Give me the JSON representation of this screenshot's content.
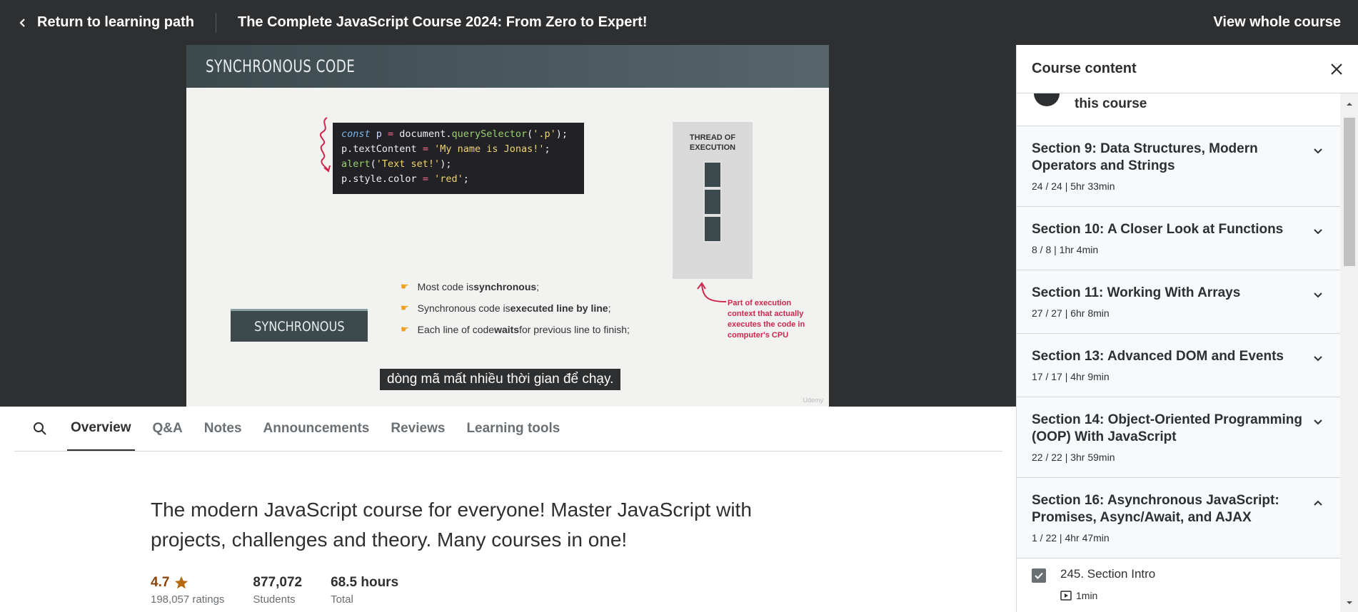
{
  "topbar": {
    "back_label": "Return to learning path",
    "course_title": "The Complete JavaScript Course 2024: From Zero to Expert!",
    "view_whole_label": "View whole course"
  },
  "video": {
    "slide_title": "SYNCHRONOUS CODE",
    "code_lines": [
      [
        "const",
        " p ",
        "=",
        " document",
        ".",
        "querySelector",
        "(",
        "'.p'",
        ");"
      ],
      [
        "p",
        ".textContent ",
        "=",
        " ",
        "'My name is Jonas!'",
        ";"
      ],
      [
        "alert",
        "(",
        "'Text set!'",
        ");"
      ],
      [
        "p",
        ".style.color ",
        "=",
        " ",
        "'red'",
        ";"
      ]
    ],
    "thread_label_1": "THREAD OF",
    "thread_label_2": "EXECUTION",
    "sync_label": "SYNCHRONOUS",
    "bullets": [
      {
        "pre": "Most code is ",
        "bold": "synchronous",
        "post": ";"
      },
      {
        "pre": "Synchronous code is ",
        "bold": "executed line by line",
        "post": ";"
      },
      {
        "pre": "Each line of code ",
        "bold": "waits",
        "post": " for previous line to finish;"
      }
    ],
    "note_lines": [
      "Part of execution",
      "context that actually",
      "executes the code in",
      "computer's CPU"
    ],
    "caption": "dòng mã mất nhiều thời gian để chạy.",
    "watermark": "Udemy",
    "accent_color": "#d0264e"
  },
  "tabs": {
    "search_icon": "search-icon",
    "items": [
      "Overview",
      "Q&A",
      "Notes",
      "Announcements",
      "Reviews",
      "Learning tools"
    ],
    "active": "Overview"
  },
  "overview": {
    "headline": "The modern JavaScript course for everyone! Master JavaScript with projects, challenges and theory. Many courses in one!",
    "rating_value": "4.7",
    "rating_count": "198,057 ratings",
    "students_value": "877,072",
    "students_label": "Students",
    "hours_value": "68.5 hours",
    "hours_label": "Total"
  },
  "sidebar": {
    "title": "Course content",
    "partial_item": "this course",
    "sections": [
      {
        "title": "Section 9: Data Structures, Modern Operators and Strings",
        "meta": "24 / 24 | 5hr 33min",
        "expanded": false
      },
      {
        "title": "Section 10: A Closer Look at Functions",
        "meta": "8 / 8 | 1hr 4min",
        "expanded": false
      },
      {
        "title": "Section 11: Working With Arrays",
        "meta": "27 / 27 | 6hr 8min",
        "expanded": false
      },
      {
        "title": "Section 13: Advanced DOM and Events",
        "meta": "17 / 17 | 4hr 9min",
        "expanded": false
      },
      {
        "title": "Section 14: Object-Oriented Programming (OOP) With JavaScript",
        "meta": "22 / 22 | 3hr 59min",
        "expanded": false
      },
      {
        "title": "Section 16: Asynchronous JavaScript: Promises, Async/Await, and AJAX",
        "meta": "1 / 22 | 4hr 47min",
        "expanded": true
      }
    ],
    "lecture": {
      "title": "245. Section Intro",
      "duration": "1min",
      "completed": true
    }
  }
}
